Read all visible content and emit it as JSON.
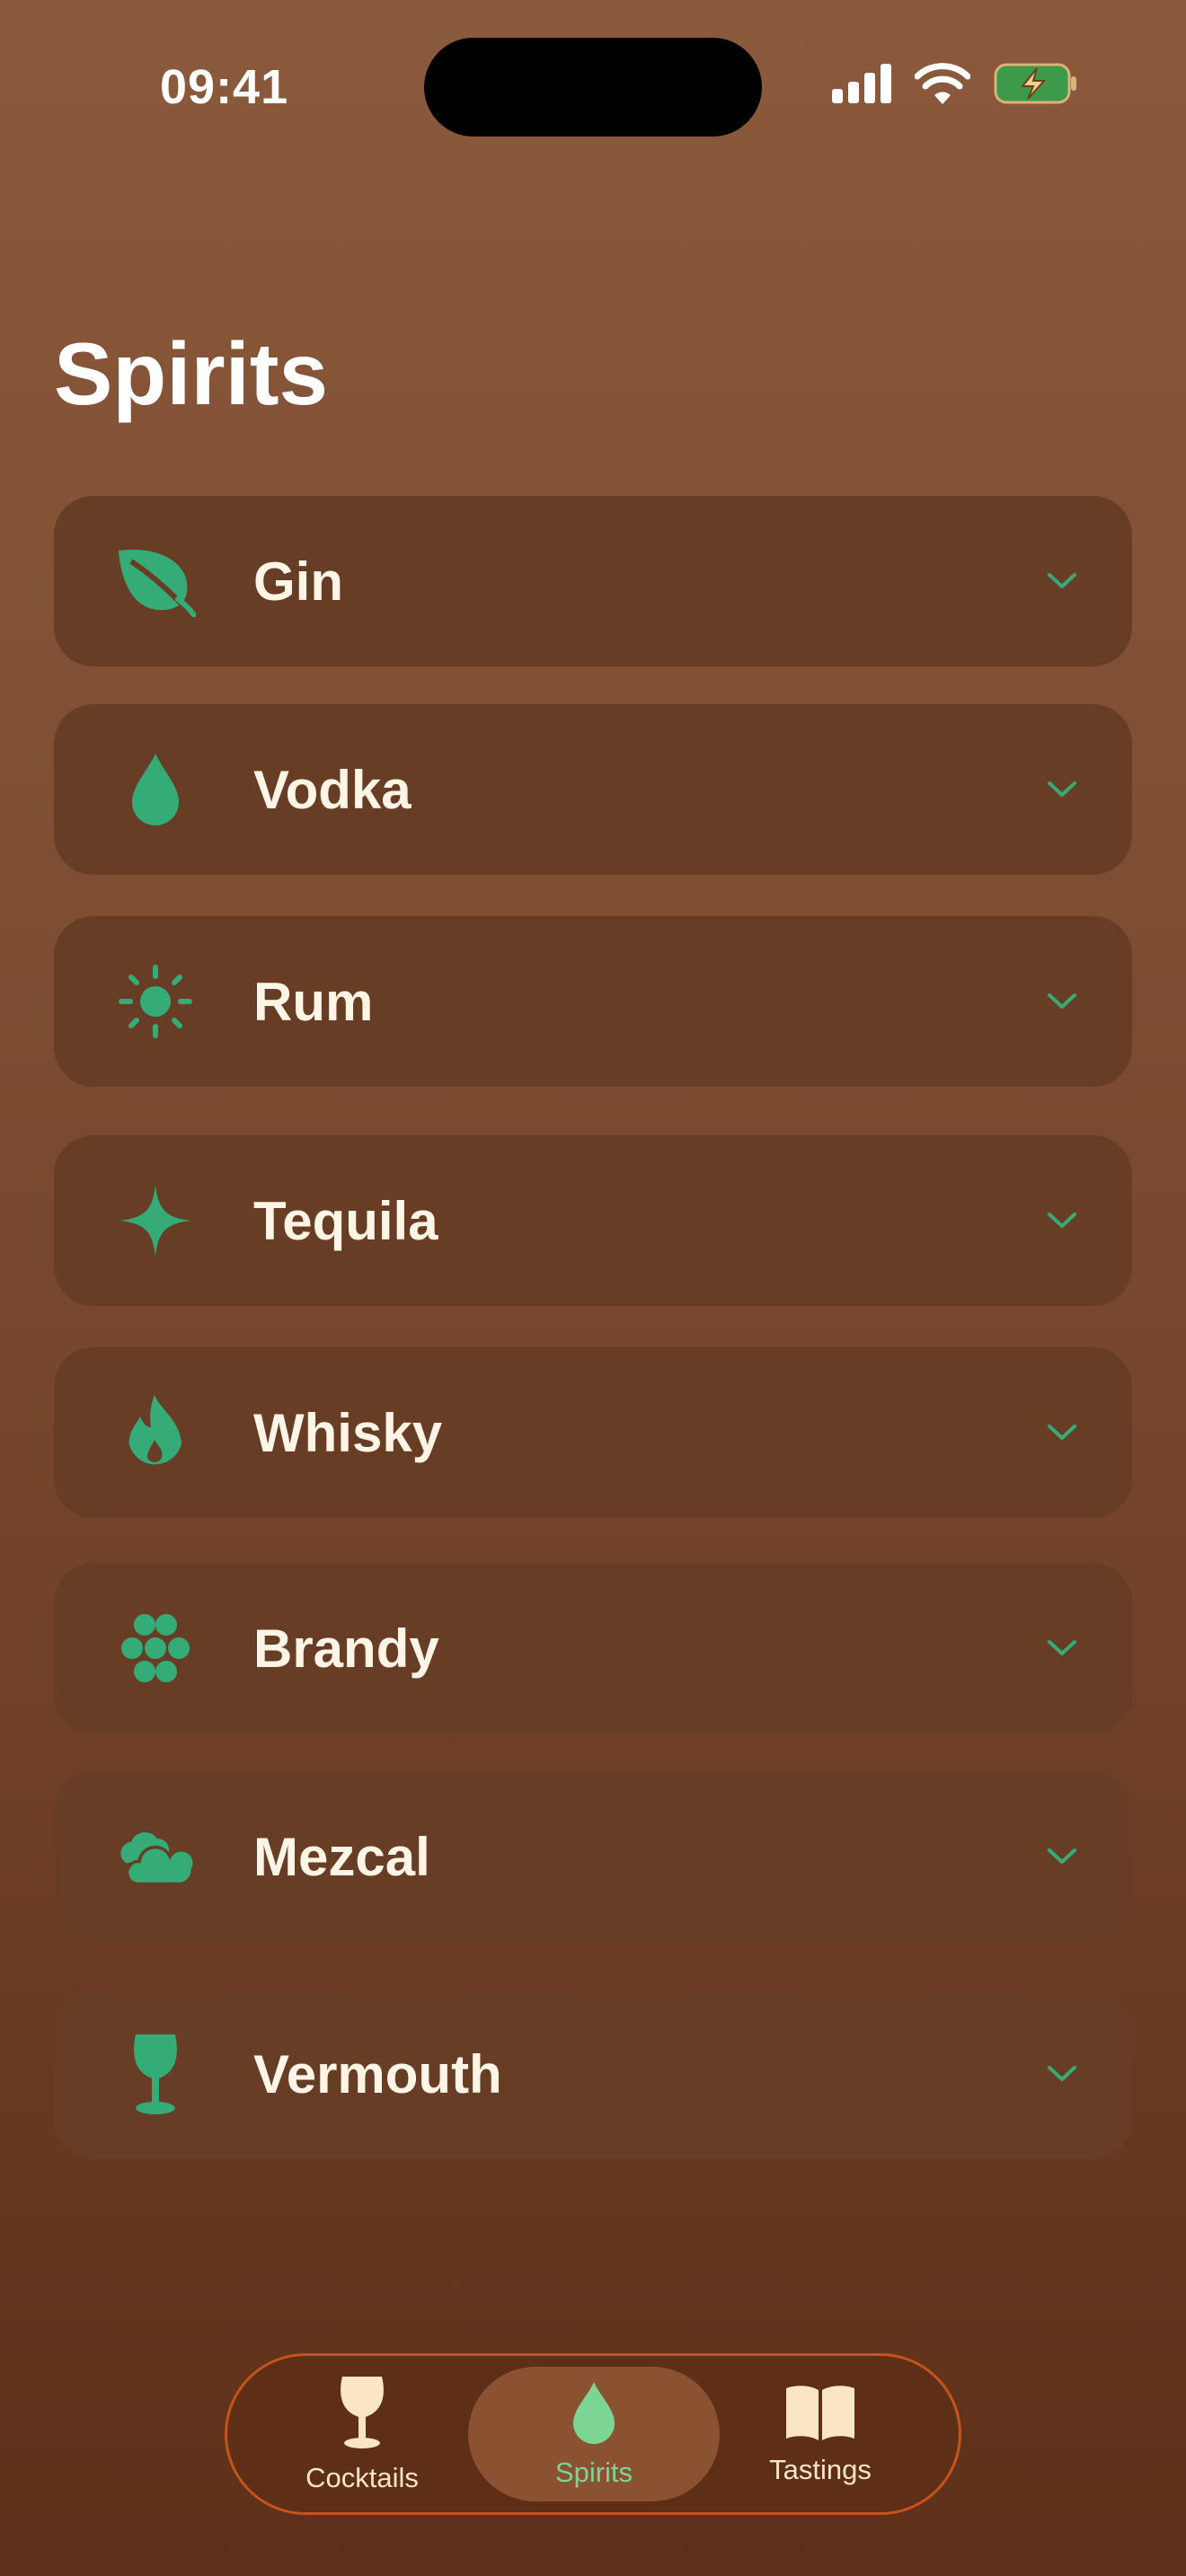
{
  "status_bar": {
    "time": "09:41"
  },
  "page": {
    "title": "Spirits"
  },
  "spirits": [
    {
      "label": "Gin",
      "icon": "leaf-icon"
    },
    {
      "label": "Vodka",
      "icon": "drop-icon"
    },
    {
      "label": "Rum",
      "icon": "sun-icon"
    },
    {
      "label": "Tequila",
      "icon": "sparkle-icon"
    },
    {
      "label": "Whisky",
      "icon": "flame-icon"
    },
    {
      "label": "Brandy",
      "icon": "grapes-icon"
    },
    {
      "label": "Mezcal",
      "icon": "cloud-icon"
    },
    {
      "label": "Vermouth",
      "icon": "wineglass-icon"
    }
  ],
  "tabbar": {
    "tabs": [
      {
        "label": "Cocktails",
        "icon": "wineglass-icon"
      },
      {
        "label": "Spirits",
        "icon": "drop-icon"
      },
      {
        "label": "Tastings",
        "icon": "book-icon"
      }
    ],
    "selected": "Spirits"
  },
  "colors": {
    "accent": "#35ab78",
    "active_tab_text": "#7cd594",
    "row_background": "#683d25",
    "tabbar_border": "#c6531b"
  }
}
